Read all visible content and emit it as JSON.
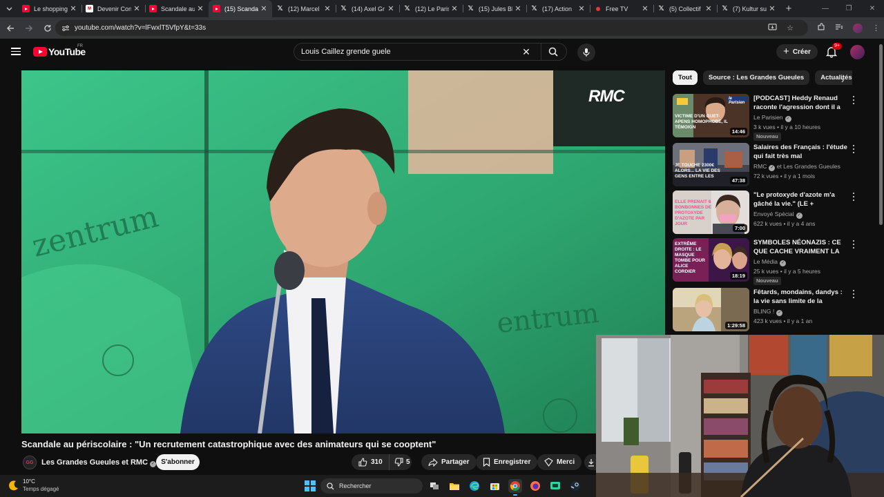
{
  "browser": {
    "tabs": [
      {
        "icon": "youtube-favicon",
        "title": "Le shopping"
      },
      {
        "icon": "mm-favicon",
        "title": "Devenir Con"
      },
      {
        "icon": "youtube-favicon",
        "title": "Scandale au"
      },
      {
        "icon": "youtube-favicon",
        "title": "(15) Scandal",
        "active": true
      },
      {
        "icon": "x-favicon",
        "title": "(12) Marcel"
      },
      {
        "icon": "x-favicon",
        "title": "(14) Axel Gr"
      },
      {
        "icon": "x-favicon",
        "title": "(12) Le Paris"
      },
      {
        "icon": "x-favicon",
        "title": "(15) Jules Bl"
      },
      {
        "icon": "x-favicon",
        "title": "(17) Action"
      },
      {
        "icon": "red-dot-favicon",
        "title": "Free TV"
      },
      {
        "icon": "x-favicon",
        "title": "(5) Collectif"
      },
      {
        "icon": "x-favicon",
        "title": "(7) Kultur su"
      }
    ],
    "url": "youtube.com/watch?v=lFwxlT5VfpY&t=33s"
  },
  "youtube": {
    "logo_text": "YouTube",
    "country_code": "FR",
    "search_query": "Louis Caillez grende guele",
    "create_label": "Créer",
    "notification_count": "9+"
  },
  "video": {
    "overlay_logo": "RMC",
    "title": "Scandale au périscolaire : \"Un recrutement catastrophique avec des animateurs qui se cooptent\"",
    "channel": "Les Grandes Gueules et RMC",
    "subscribe_label": "S'abonner",
    "likes": "310",
    "dislikes": "5",
    "share_label": "Partager",
    "save_label": "Enregistrer",
    "thanks_label": "Merci"
  },
  "chips": [
    "Tout",
    "Source : Les Grandes Gueules",
    "Actualités"
  ],
  "recommendations": [
    {
      "title": "[PODCAST] Heddy Renaud raconte l'agression dont il a ét...",
      "channel": "Le Parisien",
      "verified": true,
      "meta": "3 k vues • il y a 10 heures",
      "badge": "Nouveau",
      "duration": "14:46",
      "thumb_caption": "Victime d'un guet-apens homophobe, il témoign",
      "thumb_brand": "le Parisien",
      "thumb_colors": [
        "#5a3b2b",
        "#1f1f2e"
      ]
    },
    {
      "title": "Salaires des Français : l'étude qui fait très mal",
      "channel": "RMC",
      "channel_extra": "et Les Grandes Gueules",
      "verified": true,
      "meta": "72 k vues • il y a 1 mois",
      "badge": "",
      "duration": "47:38",
      "thumb_caption": "Je touche 2300€ alors... La vie des gens entre les",
      "thumb_colors": [
        "#6d6f7a",
        "#30323d"
      ]
    },
    {
      "title": "\"Le protoxyde d'azote m'a gâché la vie.\" (LE + D'ENVOYÉ ...",
      "channel": "Envoyé Spécial",
      "verified": true,
      "meta": "622 k vues • il y a 4 ans",
      "badge": "",
      "duration": "7:00",
      "thumb_caption": "Elle prenait 6 bonbonnes de protoxyde d'azote par jour",
      "thumb_colors": [
        "#e8e4e2",
        "#b9b2ad"
      ]
    },
    {
      "title": "SYMBOLES NÉONAZIS : CE QUE CACHE VRAIMENT LA PHOTO ...",
      "channel": "Le Média",
      "verified": true,
      "meta": "25 k vues • il y a 5 heures",
      "badge": "Nouveau",
      "duration": "18:19",
      "thumb_caption": "Extrême droite : le masque tombe pour Alice Cordier",
      "thumb_colors": [
        "#7b1f57",
        "#2a1240"
      ]
    },
    {
      "title": "Fêtards, mondains, dandys : la vie sans limite de la jeunesse ...",
      "channel": "BLING !",
      "verified": true,
      "meta": "423 k vues • il y a 1 an",
      "badge": "",
      "duration": "1:29:58",
      "thumb_caption": "",
      "thumb_colors": [
        "#d9c7a0",
        "#8a7a5f"
      ]
    }
  ],
  "taskbar": {
    "temperature": "10°C",
    "weather": "Temps dégagé",
    "search_placeholder": "Rechercher"
  }
}
